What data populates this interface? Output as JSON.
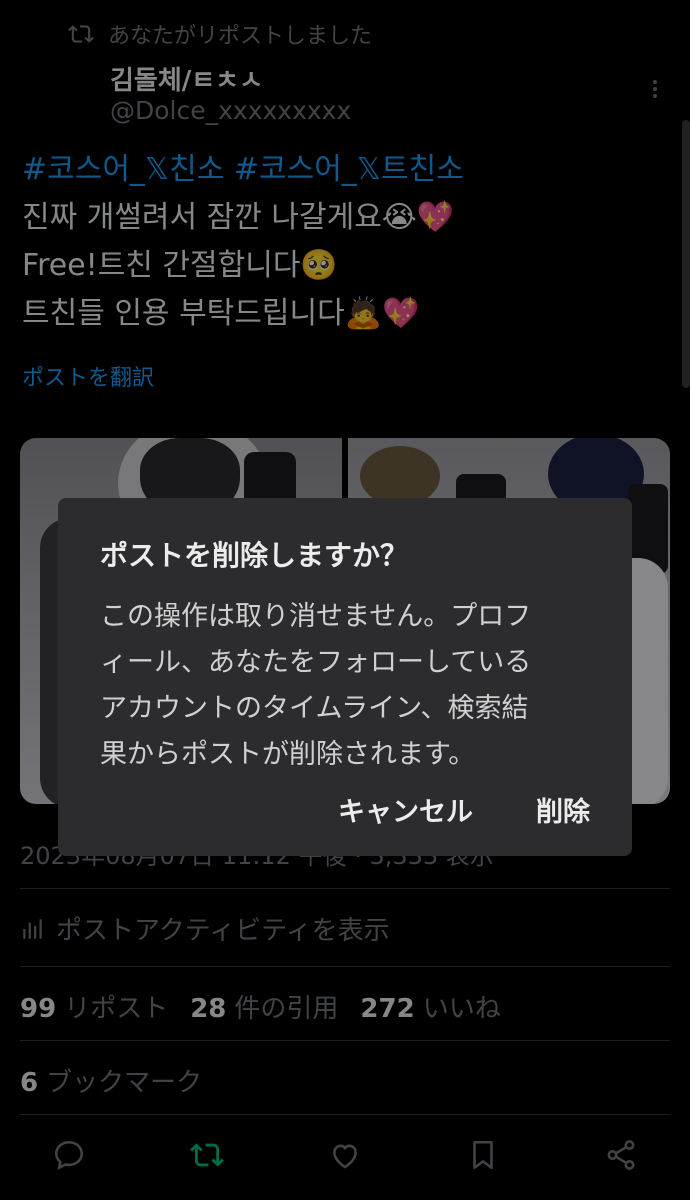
{
  "repost_notice": "あなたがリポストしました",
  "author": {
    "name": "김돌체/ㅌㅊㅅ",
    "handle": "@Dolce_xxxxxxxxx"
  },
  "post": {
    "hashtag_1": "#코스어_𝕏친소",
    "hashtag_2": "#코스어_𝕏트친소",
    "lines": [
      "진짜 개썰려서 잠깐 나갈게요😭💖",
      "Free!트친 간절합니다🥺",
      "트친들 인용 부탁드립니다🙇💖"
    ],
    "translate_label": "ポストを翻訳"
  },
  "timestamp": "2023年08月07日 11:12 午後 · 3,333 表示",
  "activity_label": "ポストアクティビティを表示",
  "stats": {
    "reposts_count": "99",
    "reposts_label": "リポスト",
    "quotes_count": "28",
    "quotes_label": "件の引用",
    "likes_count": "272",
    "likes_label": "いいね",
    "bookmarks_count": "6",
    "bookmarks_label": "ブックマーク"
  },
  "dialog": {
    "title": "ポストを削除しますか？",
    "message_lines": [
      "この操作は取り消せません。プロフ",
      "ィール、あなたをフォローしている",
      "アカウントのタイムライン、検索結",
      "果からポストが削除されます。"
    ],
    "cancel_label": "キャンセル",
    "delete_label": "削除"
  },
  "icons": [
    "repost-icon",
    "more-icon",
    "bar-chart-icon",
    "reply-icon",
    "repost-action-icon",
    "like-icon",
    "bookmark-icon",
    "share-icon"
  ],
  "colors": {
    "link": "#1d9bf0",
    "repost_active": "#00ba7c",
    "muted": "#71767b",
    "dialog_bg": "#2c2c2e"
  }
}
